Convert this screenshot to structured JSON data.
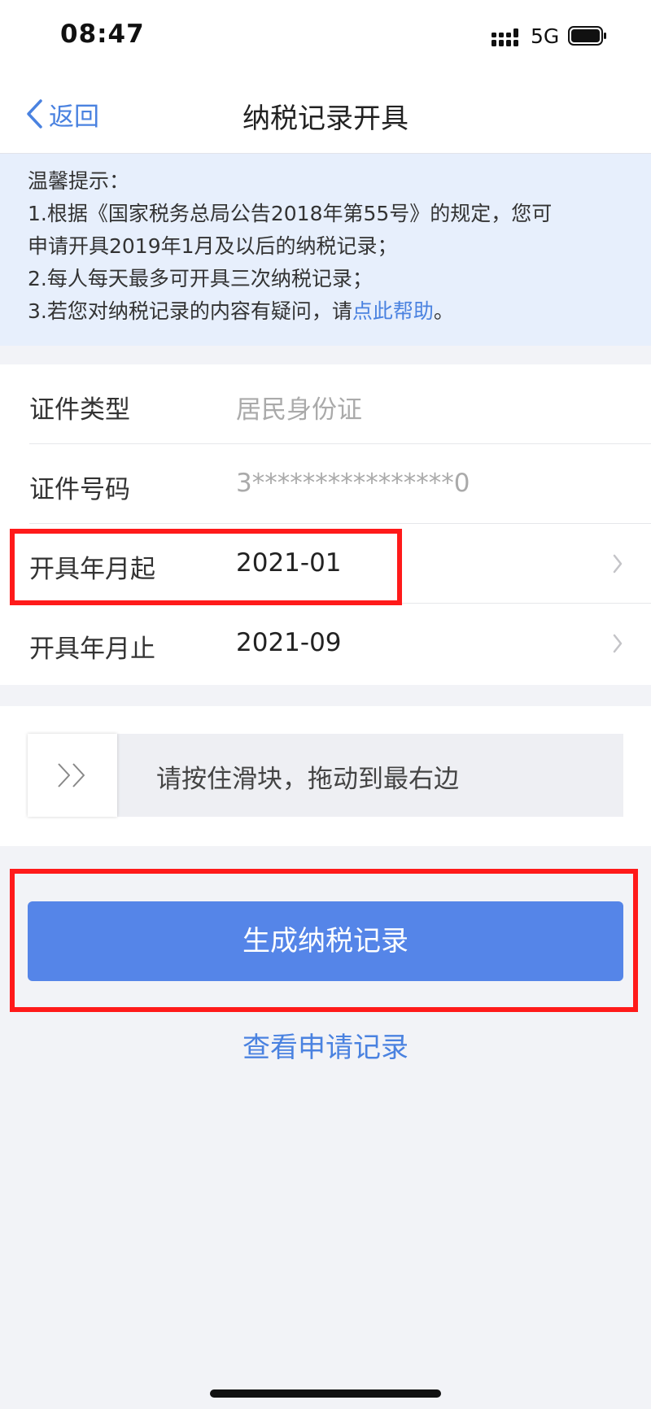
{
  "status_bar": {
    "time": "08:47",
    "network": "5G"
  },
  "nav": {
    "back_label": "返回",
    "title": "纳税记录开具"
  },
  "tips": {
    "heading": "温馨提示：",
    "line1": "1.根据《国家税务总局公告2018年第55号》的规定，您可",
    "line2": "申请开具2019年1月及以后的纳税记录；",
    "line3": "2.每人每天最多可开具三次纳税记录；",
    "line4_prefix": "3.若您对纳税记录的内容有疑问，请",
    "line4_link": "点此帮助",
    "line4_suffix": "。"
  },
  "form": {
    "id_type": {
      "label": "证件类型",
      "value": "居民身份证"
    },
    "id_number": {
      "label": "证件号码",
      "value": "3****************0"
    },
    "start": {
      "label": "开具年月起",
      "value": "2021-01"
    },
    "end": {
      "label": "开具年月止",
      "value": "2021-09"
    }
  },
  "slider": {
    "hint": "请按住滑块，拖动到最右边"
  },
  "actions": {
    "generate_label": "生成纳税记录",
    "view_records_label": "查看申请记录"
  },
  "colors": {
    "accent": "#4a82e0",
    "button": "#5585e8",
    "highlight": "#ff1a1a",
    "tips_bg": "#e7effc"
  }
}
